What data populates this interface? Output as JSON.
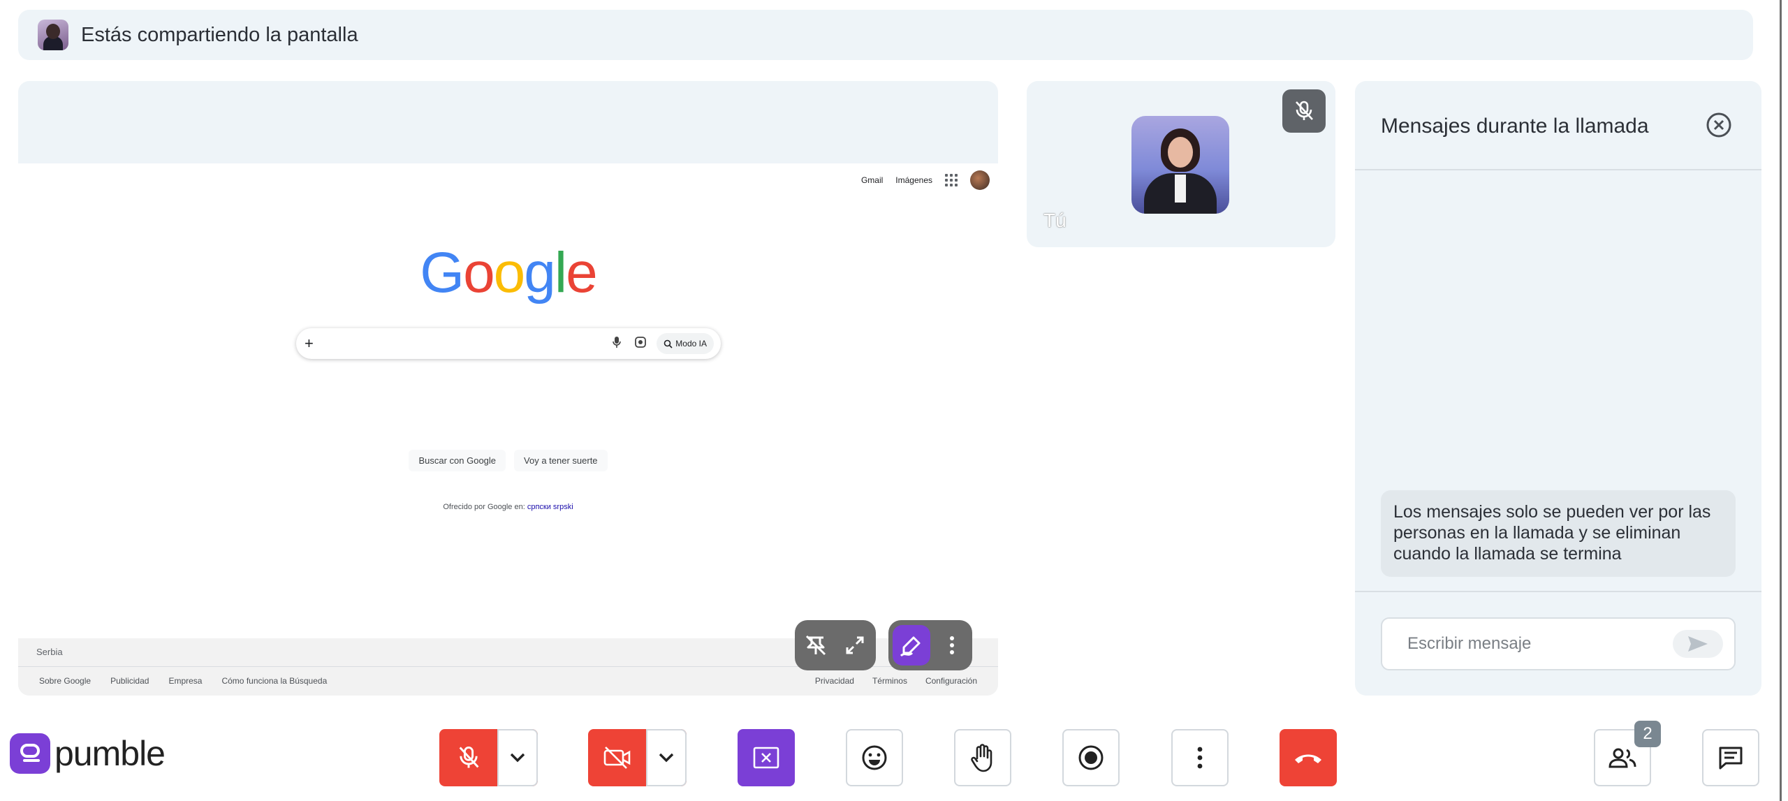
{
  "share_banner": {
    "text": "Estás compartiendo la pantalla"
  },
  "shared_screen": {
    "header_links": {
      "gmail": "Gmail",
      "images": "Imágenes"
    },
    "logo_letters": [
      "G",
      "o",
      "o",
      "g",
      "l",
      "e"
    ],
    "search": {
      "plus": "+",
      "ai_mode": "Modo IA",
      "placeholder": ""
    },
    "buttons": {
      "search": "Buscar con Google",
      "lucky": "Voy a tener suerte"
    },
    "offered_by": "Ofrecido por Google en:",
    "offered_lang": "српски srpski",
    "footer": {
      "country": "Serbia",
      "left_links": [
        "Sobre Google",
        "Publicidad",
        "Empresa",
        "Cómo funciona la Búsqueda"
      ],
      "right_links": [
        "Privacidad",
        "Términos",
        "Configuración"
      ]
    }
  },
  "self_tile": {
    "label": "Tú"
  },
  "chat": {
    "title": "Mensajes durante la llamada",
    "note": "Los mensajes solo se pueden ver por las personas en la llamada y se eliminan cuando la llamada se termina",
    "input_placeholder": "Escribir mensaje"
  },
  "brand": {
    "name": "pumble"
  },
  "toolbar": {
    "participants_count": "2"
  },
  "colors": {
    "accent": "#7b3fd6",
    "danger": "#ee4336",
    "panel": "#eef4f8"
  },
  "icons": [
    "mic-off-icon",
    "chevron-down-icon",
    "camera-off-icon",
    "stop-share-icon",
    "emoji-icon",
    "raise-hand-icon",
    "record-icon",
    "more-vertical-icon",
    "hang-up-icon",
    "people-icon",
    "chat-icon",
    "close-icon",
    "send-icon",
    "unpin-icon",
    "expand-icon",
    "annotate-icon"
  ]
}
